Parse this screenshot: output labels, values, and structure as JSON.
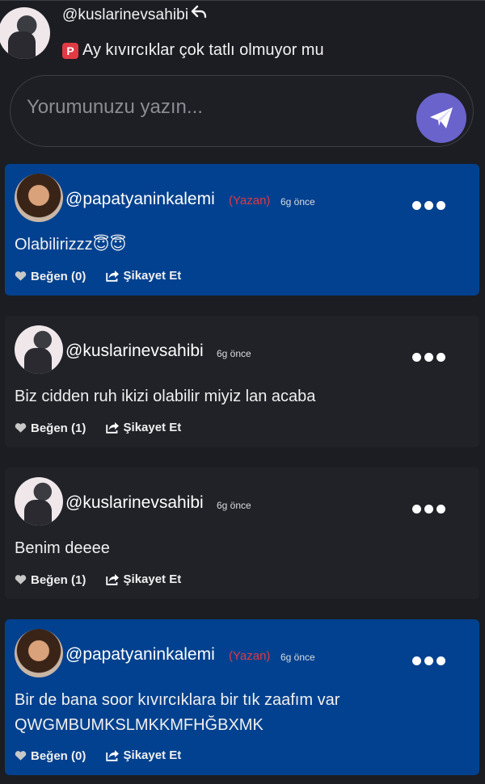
{
  "context": {
    "username": "@kuslarinevsahibi",
    "reply_icon": "reply-icon",
    "badge": "P",
    "text": "Ay kıvırcıklar çok tatlı olmuyor mu"
  },
  "composer": {
    "placeholder": "Yorumunuzu yazın...",
    "send_icon": "paper-plane-icon"
  },
  "comments": [
    {
      "username": "@papatyaninkalemi",
      "tag": "(Yazan)",
      "time": "6g önce",
      "text": "Olabilirizzz😇😇",
      "like_label": "Beğen (0)",
      "report_label": "Şikayet Et",
      "style": "blue"
    },
    {
      "username": "@kuslarinevsahibi",
      "tag": "",
      "time": "6g önce",
      "text": "Biz cidden ruh ikizi olabilir miyiz lan acaba",
      "like_label": "Beğen (1)",
      "report_label": "Şikayet Et",
      "style": "dark"
    },
    {
      "username": "@kuslarinevsahibi",
      "tag": "",
      "time": "6g önce",
      "text": "Benim deeee",
      "like_label": "Beğen (1)",
      "report_label": "Şikayet Et",
      "style": "dark"
    },
    {
      "username": "@papatyaninkalemi",
      "tag": "(Yazan)",
      "time": "6g önce",
      "text_line1": "Bir de bana soor kıvırcıklara bir tık zaafım var",
      "text_line2": "QWGMBUMKSLMKKMFHĞBXMK",
      "like_label": "Beğen (0)",
      "report_label": "Şikayet Et",
      "style": "blue"
    }
  ],
  "colors": {
    "background": "#1b1d22",
    "author_card": "#02418f",
    "reader_card": "#202227",
    "author_tag": "#e03845",
    "send_button": "#6a63cc"
  }
}
